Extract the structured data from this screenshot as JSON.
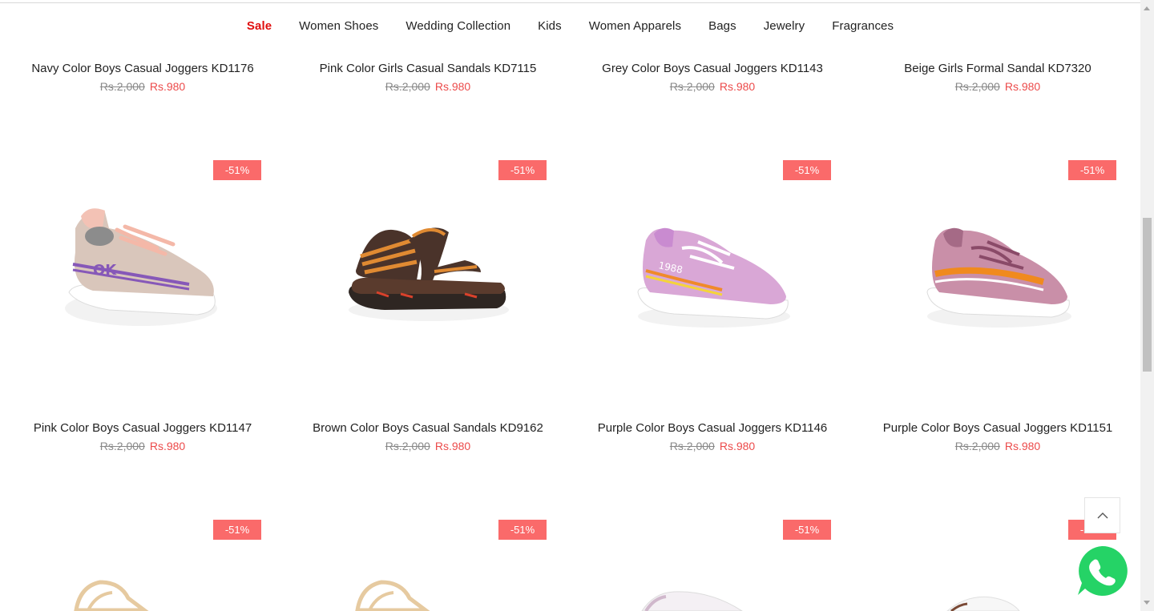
{
  "nav": {
    "items": [
      {
        "label": "Sale",
        "active": true
      },
      {
        "label": "Women Shoes"
      },
      {
        "label": "Wedding Collection"
      },
      {
        "label": "Kids"
      },
      {
        "label": "Women Apparels"
      },
      {
        "label": "Bags"
      },
      {
        "label": "Jewelry"
      },
      {
        "label": "Fragrances"
      }
    ]
  },
  "row1": [
    {
      "title": "Navy Color Boys Casual Joggers KD1176",
      "old_price": "Rs.2,000",
      "new_price": "Rs.980"
    },
    {
      "title": "Pink Color Girls Casual Sandals KD7115",
      "old_price": "Rs.2,000",
      "new_price": "Rs.980"
    },
    {
      "title": "Grey Color Boys Casual Joggers KD1143",
      "old_price": "Rs.2,000",
      "new_price": "Rs.980"
    },
    {
      "title": "Beige Girls Formal Sandal KD7320",
      "old_price": "Rs.2,000",
      "new_price": "Rs.980"
    }
  ],
  "row2": [
    {
      "title": "Pink Color Boys Casual Joggers KD1147",
      "old_price": "Rs.2,000",
      "new_price": "Rs.980",
      "badge": "-51%"
    },
    {
      "title": "Brown Color Boys Casual Sandals KD9162",
      "old_price": "Rs.2,000",
      "new_price": "Rs.980",
      "badge": "-51%"
    },
    {
      "title": "Purple Color Boys Casual Joggers KD1146",
      "old_price": "Rs.2,000",
      "new_price": "Rs.980",
      "badge": "-51%"
    },
    {
      "title": "Purple Color Boys Casual Joggers KD1151",
      "old_price": "Rs.2,000",
      "new_price": "Rs.980",
      "badge": "-51%"
    }
  ],
  "row3": [
    {
      "badge": "-51%"
    },
    {
      "badge": "-51%"
    },
    {
      "badge": "-51%"
    },
    {
      "badge": "-51%"
    }
  ],
  "colors": {
    "sale": "#e00e0e",
    "badge": "#fa6a6a",
    "new_price": "#ec4b4b",
    "old_price": "#888888",
    "whatsapp": "#25d366"
  },
  "icons": {
    "back_to_top": "chevron-up-icon",
    "whatsapp": "whatsapp-icon"
  }
}
